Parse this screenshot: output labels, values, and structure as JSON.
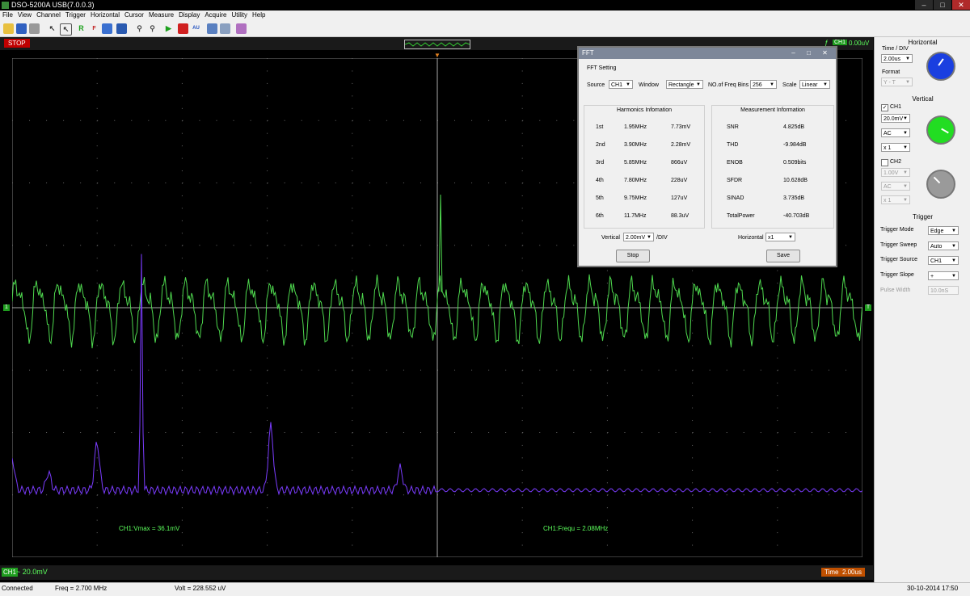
{
  "app": {
    "title": "DSO-5200A USB(7.0.0.3)"
  },
  "menu": [
    "File",
    "View",
    "Channel",
    "Trigger",
    "Horizontal",
    "Cursor",
    "Measure",
    "Display",
    "Acquire",
    "Utility",
    "Help"
  ],
  "scope": {
    "run_state": "STOP",
    "trigger_level": "0.00uV",
    "ch1_badge": "CH1",
    "ch1_scale": "~ 20.0mV",
    "time_label": "Time",
    "time_value": "2.00us",
    "meas_vmax": "CH1:Vmax = 36.1mV",
    "meas_freq": "CH1:Frequ = 2.08MHz"
  },
  "status": {
    "state": "Connected",
    "freq": "Freq = 2.700 MHz",
    "volt": "Volt = 228.552 uV",
    "datetime": "30-10-2014  17:50"
  },
  "right_panel": {
    "horizontal_title": "Horizontal",
    "time_div_label": "Time / DIV",
    "time_div": "2.00us",
    "format_label": "Format",
    "format": "Y - T",
    "vertical_title": "Vertical",
    "ch1_label": "CH1",
    "ch1_volts": "20.0mV",
    "ch1_coupling": "AC",
    "ch1_probe": "x 1",
    "ch2_label": "CH2",
    "ch2_volts": "1.00V",
    "ch2_coupling": "AC",
    "ch2_probe": "x 1",
    "trigger_title": "Trigger",
    "trigger_mode_label": "Trigger Mode",
    "trigger_mode": "Edge",
    "trigger_sweep_label": "Trigger Sweep",
    "trigger_sweep": "Auto",
    "trigger_source_label": "Trigger Source",
    "trigger_source": "CH1",
    "trigger_slope_label": "Trigger Slope",
    "trigger_slope": "+",
    "pulse_width_label": "Pulse Width",
    "pulse_width": "10.0nS",
    "colors": {
      "time_knob": "#1a3fe0",
      "ch1_knob": "#22dd22",
      "ch2_knob": "#9a9a9a"
    }
  },
  "fft": {
    "window_title": "FFT",
    "heading": "FFT Setting",
    "source_label": "Source",
    "source": "CH1",
    "window_label": "Window",
    "window": "Rectangle",
    "bins_label": "NO.of Freq Bins",
    "bins": "256",
    "scale_label": "Scale",
    "scale": "Linear",
    "harmonics_title": "Harmonics Infomation",
    "harmonics": [
      {
        "order": "1st",
        "freq": "1.95MHz",
        "amp": "7.73mV"
      },
      {
        "order": "2nd",
        "freq": "3.90MHz",
        "amp": "2.28mV"
      },
      {
        "order": "3rd",
        "freq": "5.85MHz",
        "amp": "866uV"
      },
      {
        "order": "4th",
        "freq": "7.80MHz",
        "amp": "228uV"
      },
      {
        "order": "5th",
        "freq": "9.75MHz",
        "amp": "127uV"
      },
      {
        "order": "6th",
        "freq": "11.7MHz",
        "amp": "88.3uV"
      }
    ],
    "measurement_title": "Measurement Information",
    "measurements": [
      {
        "name": "SNR",
        "value": "4.825dB"
      },
      {
        "name": "THD",
        "value": "-9.984dB"
      },
      {
        "name": "ENOB",
        "value": "0.509bits"
      },
      {
        "name": "SFDR",
        "value": "10.628dB"
      },
      {
        "name": "SINAD",
        "value": "3.735dB"
      },
      {
        "name": "TotalPower",
        "value": "-40.703dB"
      }
    ],
    "vertical_label": "Vertical",
    "vertical": "2.00mV",
    "vertical_unit": "/DIV",
    "horizontal_label": "Horizontal",
    "horizontal": "x1",
    "stop_label": "Stop",
    "save_label": "Save"
  }
}
